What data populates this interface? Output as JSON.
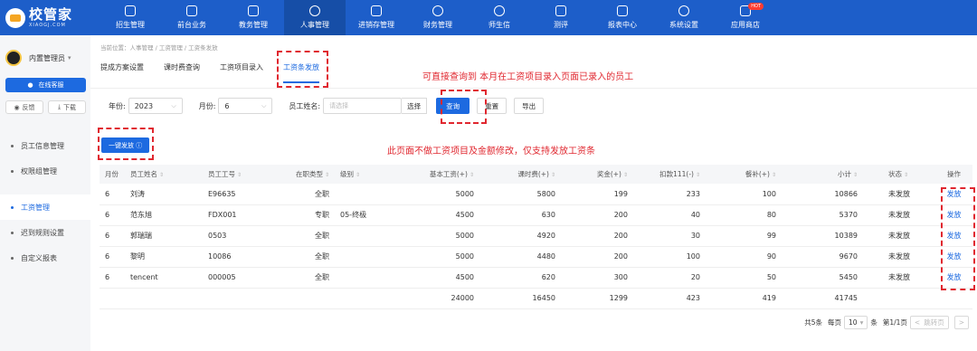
{
  "brand": {
    "name": "校管家",
    "sub": "XIAOGJ.COM"
  },
  "nav": [
    {
      "label": "招生管理",
      "icon": "user-plus-icon"
    },
    {
      "label": "前台业务",
      "icon": "monitor-icon"
    },
    {
      "label": "教务管理",
      "icon": "book-icon"
    },
    {
      "label": "人事管理",
      "icon": "person-icon",
      "active": true
    },
    {
      "label": "进销存管理",
      "icon": "inventory-icon"
    },
    {
      "label": "财务管理",
      "icon": "finance-icon"
    },
    {
      "label": "师生信",
      "icon": "chat-icon"
    },
    {
      "label": "测评",
      "icon": "check-icon"
    },
    {
      "label": "报表中心",
      "icon": "report-icon"
    },
    {
      "label": "系统设置",
      "icon": "settings-icon"
    },
    {
      "label": "应用商店",
      "icon": "apps-icon",
      "badge": "HOT"
    }
  ],
  "sidebar": {
    "user": "内置管理员",
    "online": "在线客服",
    "feedback": "反馈",
    "download": "下载",
    "items": [
      {
        "label": "员工信息管理"
      },
      {
        "label": "权限组管理"
      },
      {
        "label": "工资管理",
        "active": true
      },
      {
        "label": "迟到规则设置"
      },
      {
        "label": "自定义报表"
      }
    ]
  },
  "breadcrumb": "当前位置：人事管理 / 工资管理 / 工资条发放",
  "tabs": [
    {
      "label": "提成方案设置"
    },
    {
      "label": "课时费查询"
    },
    {
      "label": "工资项目录入"
    },
    {
      "label": "工资条发放",
      "active": true
    }
  ],
  "filters": {
    "year_label": "年份:",
    "year": "2023",
    "month_label": "月份:",
    "month": "6",
    "name_label": "员工姓名:",
    "name_placeholder": "请选择",
    "pick": "选择",
    "query": "查询",
    "reset": "重置",
    "export": "导出"
  },
  "bulk_button": "一键发放 ⓘ",
  "annotations": {
    "top": "可直接查询到 本月在工资项目录入页面已录入的员工",
    "middle": "此页面不做工资项目及金额修改，仅支持发放工资条"
  },
  "table": {
    "headers": [
      "月份",
      "员工姓名",
      "员工工号",
      "在职类型",
      "级别",
      "基本工资(+)",
      "课时费(+)",
      "奖金(+)",
      "扣款111(-)",
      "餐补(+)",
      "小计",
      "状态",
      "操作"
    ],
    "rows": [
      [
        "6",
        "刘涛",
        "E96635",
        "全职",
        "",
        "5000",
        "5800",
        "199",
        "233",
        "100",
        "10866",
        "未发放",
        "发放"
      ],
      [
        "6",
        "范东旭",
        "FDX001",
        "专职",
        "05-终极",
        "4500",
        "630",
        "200",
        "40",
        "80",
        "5370",
        "未发放",
        "发放"
      ],
      [
        "6",
        "郭瑞瑞",
        "0503",
        "全职",
        "",
        "5000",
        "4920",
        "200",
        "30",
        "99",
        "10389",
        "未发放",
        "发放"
      ],
      [
        "6",
        "黎明",
        "10086",
        "全职",
        "",
        "5000",
        "4480",
        "200",
        "100",
        "90",
        "9670",
        "未发放",
        "发放"
      ],
      [
        "6",
        "tencent",
        "000005",
        "全职",
        "",
        "4500",
        "620",
        "300",
        "20",
        "50",
        "5450",
        "未发放",
        "发放"
      ]
    ],
    "totals": [
      "",
      "",
      "",
      "",
      "",
      "24000",
      "16450",
      "1299",
      "423",
      "419",
      "41745",
      "",
      ""
    ]
  },
  "pager": {
    "total": "共5条",
    "per_page_label": "每页",
    "per_page": "10",
    "unit": "条",
    "page": "第1/1页",
    "prev": "<",
    "jump": "跳转页",
    "next": ">"
  }
}
